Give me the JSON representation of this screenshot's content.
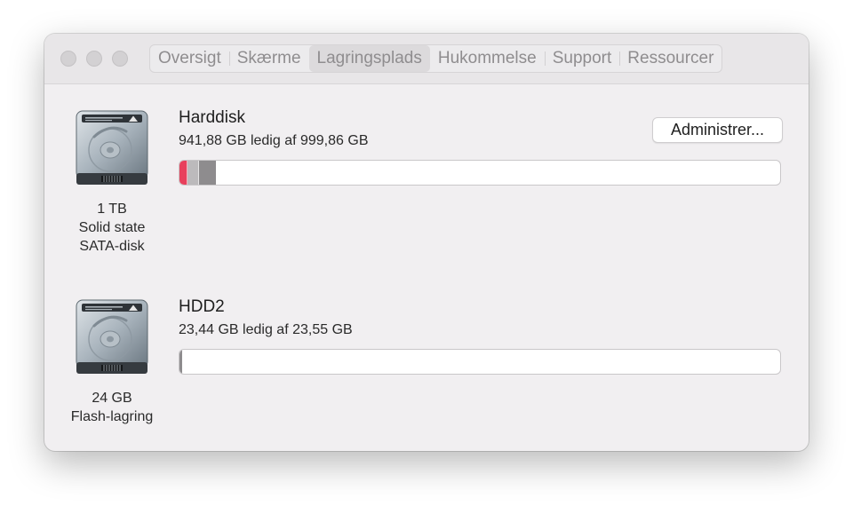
{
  "window": {
    "tabs": [
      {
        "label": "Oversigt",
        "selected": false
      },
      {
        "label": "Skærme",
        "selected": false
      },
      {
        "label": "Lagringsplads",
        "selected": true
      },
      {
        "label": "Hukommelse",
        "selected": false
      },
      {
        "label": "Support",
        "selected": false
      },
      {
        "label": "Ressourcer",
        "selected": false
      }
    ]
  },
  "disks": [
    {
      "name": "Harddisk",
      "free_text": "941,88 GB ledig af 999,86 GB",
      "caption": [
        "1 TB",
        "Solid state",
        "SATA-disk"
      ],
      "manage_label": "Administrer...",
      "icon": "hard-drive-icon",
      "usage_segments": [
        {
          "fraction": 0.012,
          "color": "#e8405c"
        },
        {
          "fraction": 0.018,
          "color": "#bcbabc"
        },
        {
          "fraction": 0.027,
          "color": "#8e8c8e"
        }
      ]
    },
    {
      "name": "HDD2",
      "free_text": "23,44 GB ledig af 23,55 GB",
      "caption": [
        "24 GB",
        "Flash-lagring"
      ],
      "icon": "hard-drive-icon",
      "usage_segments": [
        {
          "fraction": 0.005,
          "color": "#8e8c8e"
        }
      ]
    }
  ],
  "colors": {
    "window_bg": "#f1eff1",
    "titlebar_bg": "#e8e6e8",
    "accent_red": "#e8405c"
  }
}
